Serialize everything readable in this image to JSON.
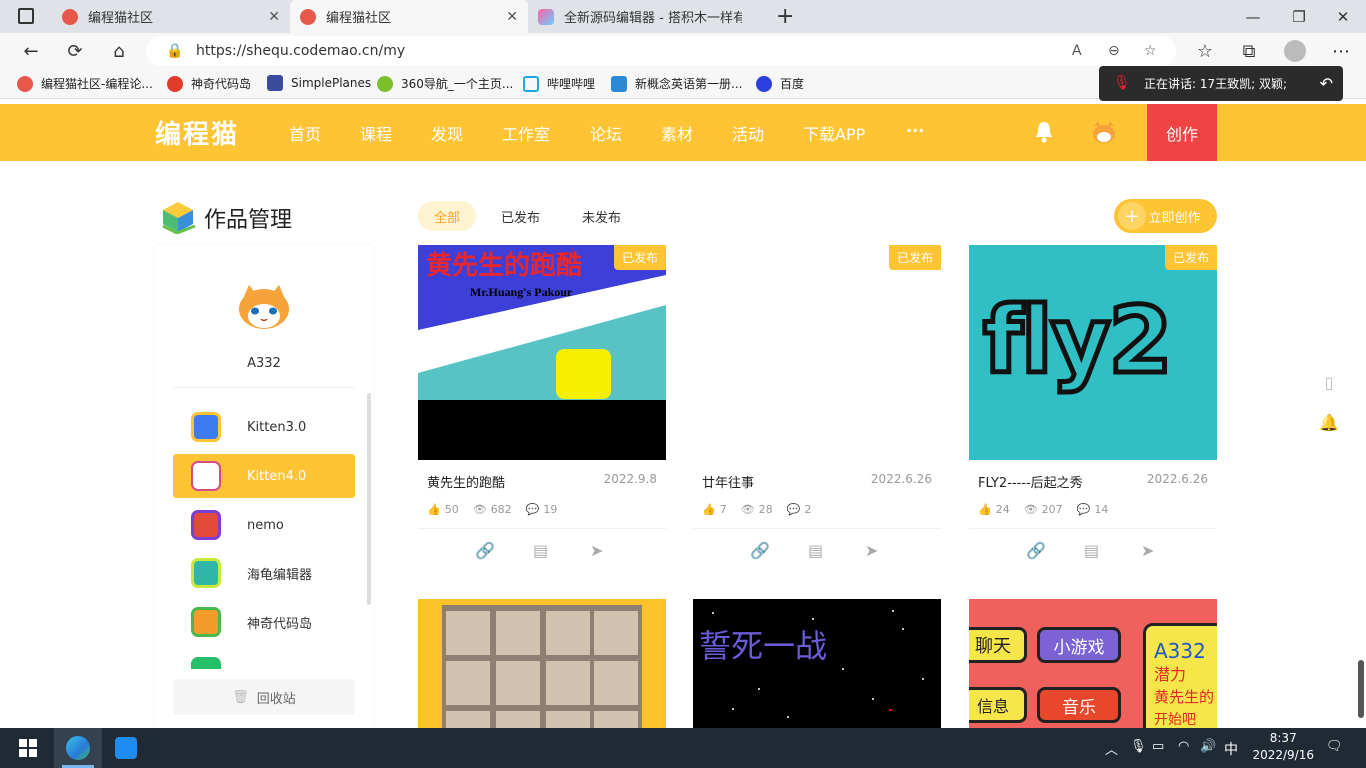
{
  "browser": {
    "tabs": [
      {
        "title": "编程猫社区",
        "active": false
      },
      {
        "title": "编程猫社区",
        "active": true
      },
      {
        "title": "全新源码编辑器 - 搭积木一样有趣",
        "active": false
      }
    ],
    "url": "https://shequ.codemao.cn/my",
    "bookmarks": [
      "编程猫社区-编程论...",
      "神奇代码岛",
      "SimplePlanes",
      "360导航_一个主页...",
      "哔哩哔哩",
      "新概念英语第一册...",
      "百度"
    ],
    "speaking": "正在讲话: 17王致凯; 双颖;"
  },
  "header": {
    "logo": "编程猫",
    "nav": [
      "首页",
      "课程",
      "发现",
      "工作室",
      "论坛",
      "素材",
      "活动",
      "下载APP",
      "···"
    ],
    "create": "创作"
  },
  "page": {
    "title": "作品管理",
    "username": "A332",
    "sidebar": [
      {
        "label": "Kitten3.0",
        "active": false,
        "color": "#3d7bf2"
      },
      {
        "label": "Kitten4.0",
        "active": true,
        "color": "#d44b8c"
      },
      {
        "label": "nemo",
        "active": false,
        "color": "#e34a3a"
      },
      {
        "label": "海龟编辑器",
        "active": false,
        "color": "#2fb7a8"
      },
      {
        "label": "神奇代码岛",
        "active": false,
        "color": "#f29d2a"
      },
      {
        "label": "小说",
        "active": false,
        "color": "#27c06a"
      }
    ],
    "trash": "回收站",
    "filters": [
      "全部",
      "已发布",
      "未发布"
    ],
    "new_work": "立即创作"
  },
  "works": [
    {
      "title": "黄先生的跑酷",
      "date": "2022.9.8",
      "likes": "50",
      "views": "682",
      "comments": "19",
      "badge": "已发布",
      "thumb_title": "黄先生的跑酷",
      "thumb_subtitle": "Mr.Huang's Pakour"
    },
    {
      "title": "廿年往事",
      "date": "2022.6.26",
      "likes": "7",
      "views": "28",
      "comments": "2",
      "badge": "已发布"
    },
    {
      "title": "FLY2-----后起之秀",
      "date": "2022.6.26",
      "likes": "24",
      "views": "207",
      "comments": "14",
      "badge": "已发布",
      "thumb_title": "fly2"
    }
  ],
  "works_row2": [
    {
      "thumb_title": ""
    },
    {
      "thumb_title": "誓死一战"
    },
    {
      "thumb_labels": [
        "聊天",
        "小游戏",
        "信息",
        "音乐"
      ],
      "thumb_side": [
        "A332",
        "潜力",
        "黄先生的",
        "开始吧"
      ]
    }
  ],
  "taskbar": {
    "time": "8:37",
    "date": "2022/9/16",
    "ime": "中"
  }
}
